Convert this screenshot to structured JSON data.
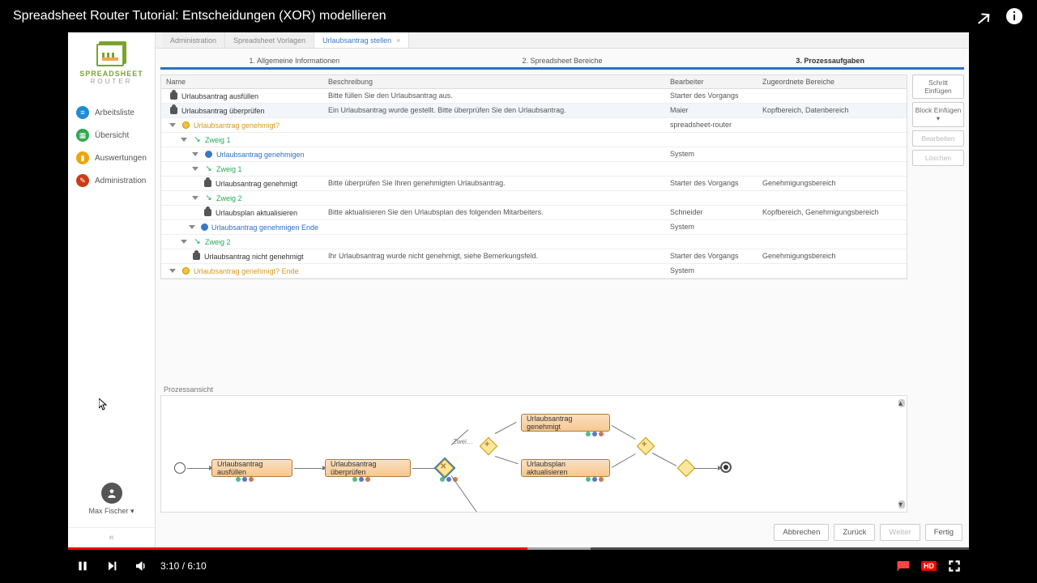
{
  "video": {
    "title": "Spreadsheet Router Tutorial: Entscheidungen (XOR) modellieren",
    "time_current": "3:10",
    "time_total": "6:10",
    "progress_played_pct": 51,
    "progress_buffer_pct": 58,
    "quality_badge": "HD"
  },
  "app": {
    "brand_line1": "SPREADSHEET",
    "brand_line2": "ROUTER",
    "nav": {
      "worklist": "Arbeitsliste",
      "overview": "Übersicht",
      "reports": "Auswertungen",
      "admin": "Administration"
    },
    "user": {
      "name": "Max Fischer"
    },
    "tabs": {
      "admin": "Administration",
      "templates": "Spreadsheet Vorlagen",
      "active": "Urlaubsantrag stellen"
    },
    "wizard": {
      "step1": "1. Allgemeine Informationen",
      "step2": "2. Spreadsheet Bereiche",
      "step3": "3. Prozessaufgaben"
    },
    "table": {
      "headers": {
        "name": "Name",
        "desc": "Beschreibung",
        "editor": "Bearbeiter",
        "zones": "Zugeordnete Bereiche"
      },
      "rows": [
        {
          "indent": 0,
          "kind": "task",
          "name": "Urlaubsantrag ausfüllen",
          "desc": "Bitte füllen Sie den Urlaubsantrag aus.",
          "editor": "Starter des Vorgangs",
          "zones": ""
        },
        {
          "indent": 0,
          "kind": "task",
          "name": "Urlaubsantrag überprüfen",
          "desc": "Ein Urlaubsantrag wurde gestellt. Bitte überprüfen Sie den Urlaubsantrag.",
          "editor": "Maier",
          "zones": "Kopfbereich, Datenbereich"
        },
        {
          "indent": 0,
          "kind": "xor",
          "name": "Urlaubsantrag genehmigt?",
          "desc": "",
          "editor": "spreadsheet-router",
          "zones": ""
        },
        {
          "indent": 1,
          "kind": "branch",
          "name": "Zweig 1",
          "desc": "",
          "editor": "",
          "zones": ""
        },
        {
          "indent": 2,
          "kind": "link",
          "name": "Urlaubsantrag genehmigen",
          "desc": "",
          "editor": "System",
          "zones": ""
        },
        {
          "indent": 2,
          "kind": "branch",
          "name": "Zweig 1",
          "desc": "",
          "editor": "",
          "zones": ""
        },
        {
          "indent": 3,
          "kind": "task",
          "name": "Urlaubsantrag genehmigt",
          "desc": "Bitte überprüfen Sie Ihren genehmigten Urlaubsantrag.",
          "editor": "Starter des Vorgangs",
          "zones": "Genehmigungsbereich"
        },
        {
          "indent": 2,
          "kind": "branch",
          "name": "Zweig 2",
          "desc": "",
          "editor": "",
          "zones": ""
        },
        {
          "indent": 3,
          "kind": "task",
          "name": "Urlaubsplan aktualisieren",
          "desc": "Bitte aktualisieren Sie den Urlaubsplan des folgenden Mitarbeiters.",
          "editor": "Schneider",
          "zones": "Kopfbereich, Genehmigungsbereich"
        },
        {
          "indent": 2,
          "kind": "link",
          "name": "Urlaubsantrag genehmigen Ende",
          "desc": "",
          "editor": "System",
          "zones": ""
        },
        {
          "indent": 1,
          "kind": "branch",
          "name": "Zweig 2",
          "desc": "",
          "editor": "",
          "zones": ""
        },
        {
          "indent": 2,
          "kind": "task",
          "name": "Urlaubsantrag nicht genehmigt",
          "desc": "Ihr Urlaubsantrag wurde nicht genehmigt, siehe Bemerkungsfeld.",
          "editor": "Starter des Vorgangs",
          "zones": "Genehmigungsbereich"
        },
        {
          "indent": 0,
          "kind": "xor",
          "name": "Urlaubsantrag genehmigt? Ende",
          "desc": "",
          "editor": "System",
          "zones": ""
        }
      ]
    },
    "side_buttons": {
      "insert_step": "Schritt Einfügen",
      "insert_block": "Block Einfügen",
      "edit": "Bearbeiten",
      "delete": "Löschen"
    },
    "diagram": {
      "title": "Prozessansicht",
      "branch_label": "Zwei…",
      "nodes": {
        "n1": "Urlaubsantrag ausfüllen",
        "n2": "Urlaubsantrag überprüfen",
        "n3": "Urlaubsantrag genehmigt",
        "n4": "Urlaubsplan aktualisieren"
      }
    },
    "footer": {
      "cancel": "Abbrechen",
      "back": "Zurück",
      "next": "Weiter",
      "done": "Fertig"
    }
  }
}
